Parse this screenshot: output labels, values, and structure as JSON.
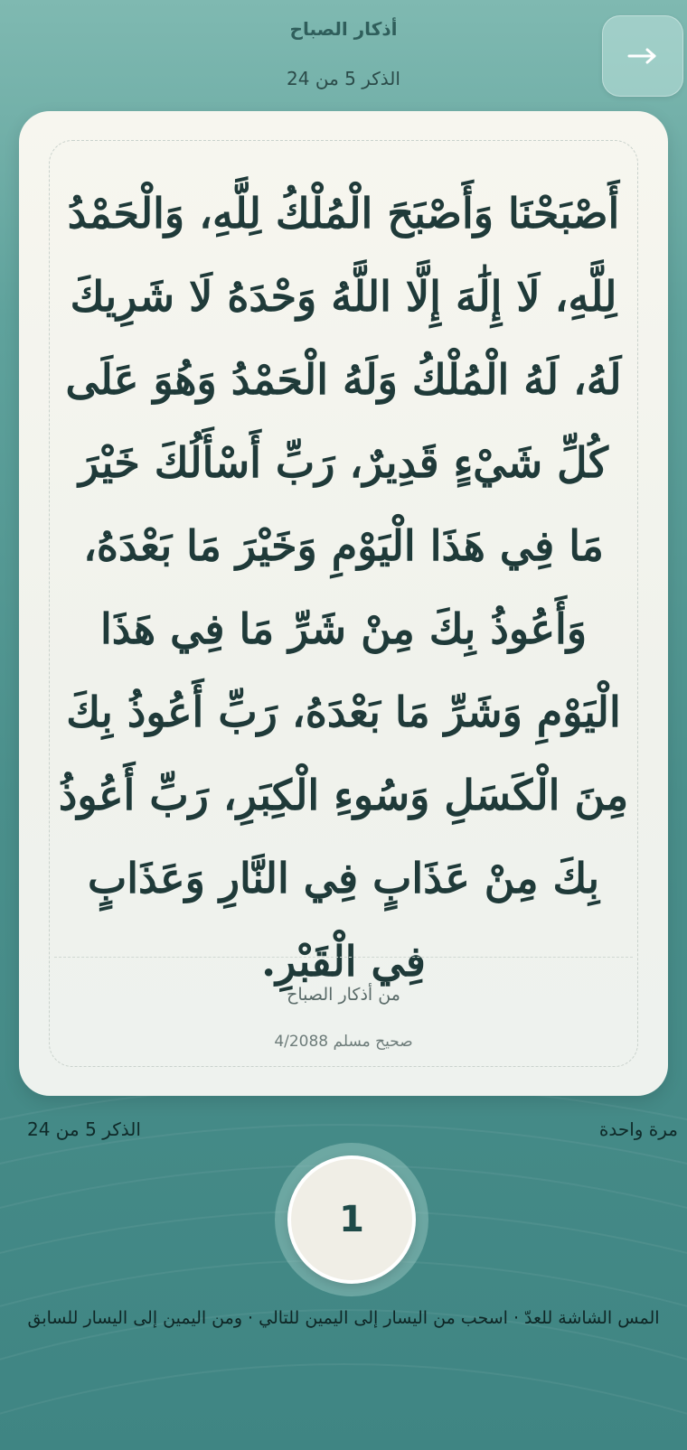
{
  "header": {
    "title": "أذكار الصباح",
    "progress": "الذكر 5 من 24"
  },
  "next_button": {
    "icon": "arrow-right-icon"
  },
  "card": {
    "text": "أَصْبَحْنَا وَأَصْبَحَ الْمُلْكُ لِلَّهِ، وَالْحَمْدُ لِلَّهِ، لَا إِلَٰهَ إِلَّا اللَّهُ وَحْدَهُ لَا شَرِيكَ لَهُ، لَهُ الْمُلْكُ وَلَهُ الْحَمْدُ وَهُوَ عَلَى كُلِّ شَيْءٍ قَدِيرٌ، رَبِّ أَسْأَلُكَ خَيْرَ مَا فِي هَذَا الْيَوْمِ وَخَيْرَ مَا بَعْدَهُ، وَأَعُوذُ بِكَ مِنْ شَرِّ مَا فِي هَذَا الْيَوْمِ وَشَرِّ مَا بَعْدَهُ، رَبِّ أَعُوذُ بِكَ مِنَ الْكَسَلِ وَسُوءِ الْكِبَرِ، رَبِّ أَعُوذُ بِكَ مِنْ عَذَابٍ فِي النَّارِ وَعَذَابٍ فِي الْقَبْرِ.",
    "category": "من أذكار الصباح",
    "source": "صحيح مسلم 4/2088"
  },
  "meta": {
    "repeat": "مرة واحدة",
    "progress": "الذكر 5 من 24"
  },
  "counter": {
    "value": "1"
  },
  "instructions": "المس الشاشة للعدّ · اسحب من اليسار إلى اليمين للتالي · ومن اليمين إلى اليسار للسابق",
  "colors": {
    "background_top": "#7fb9b1",
    "background_bottom": "#3f8583",
    "card": "#f4f5ef",
    "text_dark": "#1f3a39"
  }
}
